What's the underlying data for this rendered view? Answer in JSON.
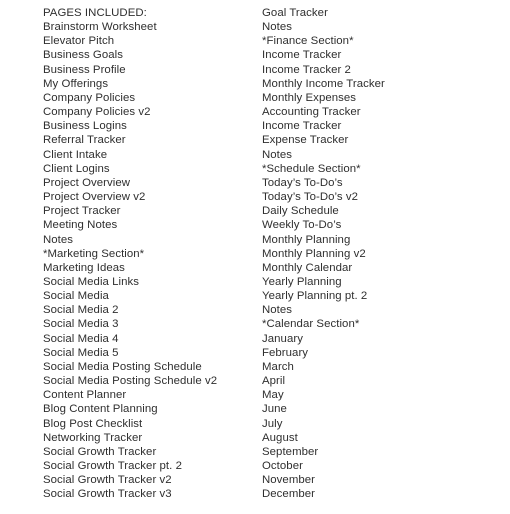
{
  "document": {
    "kind": "pages-included-list",
    "background_color": "#ffffff",
    "text_color": "#2f2f2f"
  },
  "columns": [
    {
      "name": "left-column",
      "items": [
        "PAGES INCLUDED:",
        "Brainstorm Worksheet",
        "Elevator Pitch",
        "Business Goals",
        "Business Profile",
        "My Offerings",
        "Company Policies",
        "Company Policies v2",
        "Business Logins",
        "Referral Tracker",
        "Client Intake",
        "Client Logins",
        "Project Overview",
        "Project Overview v2",
        "Project Tracker",
        "Meeting Notes",
        "Notes",
        "*Marketing Section*",
        "Marketing Ideas",
        "Social Media Links",
        "Social Media",
        "Social Media 2",
        "Social Media 3",
        "Social Media 4",
        "Social Media 5",
        "Social Media Posting Schedule",
        "Social Media Posting Schedule v2",
        "Content Planner",
        "Blog Content Planning",
        "Blog Post Checklist",
        "Networking Tracker",
        "Social Growth Tracker",
        "Social Growth Tracker pt. 2",
        "Social Growth Tracker v2",
        "Social Growth Tracker v3"
      ]
    },
    {
      "name": "right-column",
      "items": [
        "Goal Tracker",
        "Notes",
        "*Finance Section*",
        "Income Tracker",
        "Income Tracker 2",
        "Monthly Income Tracker",
        "Monthly Expenses",
        "Accounting Tracker",
        "Income Tracker",
        "Expense Tracker",
        "Notes",
        "*Schedule Section*",
        "Today’s To-Do’s",
        "Today’s To-Do’s v2",
        "Daily Schedule",
        "Weekly To-Do’s",
        "Monthly Planning",
        "Monthly Planning v2",
        "Monthly Calendar",
        "Yearly Planning",
        "Yearly Planning pt. 2",
        "Notes",
        "*Calendar Section*",
        "January",
        "February",
        "March",
        "April",
        "May",
        "June",
        "July",
        "August",
        "September",
        "October",
        "November",
        "December"
      ]
    }
  ]
}
